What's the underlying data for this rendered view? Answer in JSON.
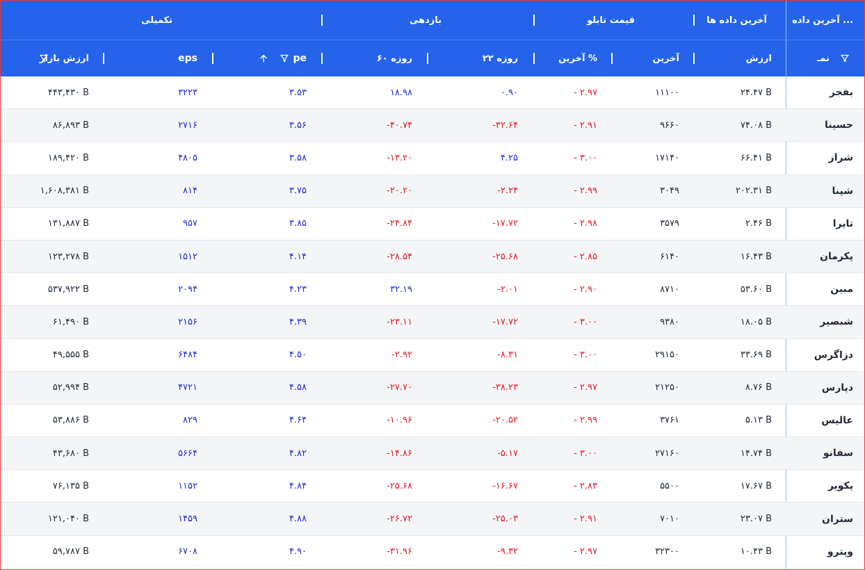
{
  "top_headers": {
    "latest_data": "آخرین داده ...",
    "latest_datas": "آخرین داده ها",
    "board_price": "قیمت تابلو",
    "returns": "بازدهی",
    "supplementary": "تکمیلی"
  },
  "columns": {
    "symbol": "نمـ",
    "value": "ارزش",
    "last": "آخرین",
    "last_pct": "آخرین %",
    "r22": "۲۲ روزه",
    "r60": "۶۰ روزه",
    "pe": "pe",
    "eps": "eps",
    "market_cap": "ارزش بازار"
  },
  "icons": {
    "filter": "filter-icon",
    "sort_up": "sort-up-arrow-icon"
  },
  "colors": {
    "header_bg": "#2563eb",
    "negative": "#e31b23",
    "positive": "#1e2bd6",
    "frame": "#e53935"
  },
  "rows": [
    {
      "symbol": "بفجر",
      "value": "۲۴.۴۷ B",
      "last": "۱۱۱۰۰",
      "last_pct": "- ۲.۹۷",
      "r22": "۰.۹۰",
      "r22_pos": true,
      "r60": "۱۸.۹۸",
      "r60_pos": true,
      "pe": "۳.۵۳",
      "eps": "۳۲۲۳",
      "market_cap": "۴۴۳,۴۳۰ B"
    },
    {
      "symbol": "حسینا",
      "value": "۷۴.۰۸ B",
      "last": "۹۶۶۰",
      "last_pct": "- ۲.۹۱",
      "r22": "-۳۲.۶۴",
      "r22_pos": false,
      "r60": "-۴۰.۷۴",
      "r60_pos": false,
      "pe": "۳.۵۶",
      "eps": "۲۷۱۶",
      "market_cap": "۸۶,۸۹۳ B"
    },
    {
      "symbol": "شراز",
      "value": "۶۶.۴۱ B",
      "last": "۱۷۱۴۰",
      "last_pct": "- ۳.۰۰",
      "r22": "۴.۲۵",
      "r22_pos": true,
      "r60": "-۱۳.۲۰",
      "r60_pos": false,
      "pe": "۳.۵۸",
      "eps": "۴۸۰۵",
      "market_cap": "۱۸۹,۴۲۰ B"
    },
    {
      "symbol": "شپنا",
      "value": "۲۰۲.۳۱ B",
      "last": "۳۰۴۹",
      "last_pct": "- ۲.۹۹",
      "r22": "-۲.۲۴",
      "r22_pos": false,
      "r60": "-۲۰.۲۰",
      "r60_pos": false,
      "pe": "۳.۷۵",
      "eps": "۸۱۴",
      "market_cap": "۱,۶۰۸,۳۸۱ B"
    },
    {
      "symbol": "تایرا",
      "value": "۲.۴۶ B",
      "last": "۳۵۷۹",
      "last_pct": "- ۲.۹۸",
      "r22": "-۱۷.۷۲",
      "r22_pos": false,
      "r60": "-۲۴.۸۴",
      "r60_pos": false,
      "pe": "۳.۸۵",
      "eps": "۹۵۷",
      "market_cap": "۱۳۱,۸۸۷ B"
    },
    {
      "symbol": "پکرمان",
      "value": "۱۶.۴۳ B",
      "last": "۶۱۴۰",
      "last_pct": "- ۲.۸۵",
      "r22": "-۲۵.۶۸",
      "r22_pos": false,
      "r60": "-۲۸.۵۴",
      "r60_pos": false,
      "pe": "۴.۱۴",
      "eps": "۱۵۱۲",
      "market_cap": "۱۲۳,۲۷۸ B"
    },
    {
      "symbol": "مبین",
      "value": "۵۳.۶۰ B",
      "last": "۸۷۱۰",
      "last_pct": "- ۲.۹۰",
      "r22": "-۲.۰۱",
      "r22_pos": false,
      "r60": "۳۲.۱۹",
      "r60_pos": true,
      "pe": "۴.۲۳",
      "eps": "۲۰۹۴",
      "market_cap": "۵۳۷,۹۲۲ B"
    },
    {
      "symbol": "شبصیر",
      "value": "۱۸.۰۵ B",
      "last": "۹۳۸۰",
      "last_pct": "- ۳.۰۰",
      "r22": "-۱۷.۷۲",
      "r22_pos": false,
      "r60": "-۲۳.۱۱",
      "r60_pos": false,
      "pe": "۴.۳۹",
      "eps": "۲۱۵۶",
      "market_cap": "۶۱,۴۹۰ B"
    },
    {
      "symbol": "دزاگرس",
      "value": "۳۳.۶۹ B",
      "last": "۲۹۱۵۰",
      "last_pct": "- ۳.۰۰",
      "r22": "-۸.۳۱",
      "r22_pos": false,
      "r60": "-۲.۹۲",
      "r60_pos": false,
      "pe": "۴.۵۰",
      "eps": "۶۴۸۴",
      "market_cap": "۴۹,۵۵۵ B"
    },
    {
      "symbol": "دپارس",
      "value": "۸.۷۶ B",
      "last": "۲۱۲۵۰",
      "last_pct": "- ۲.۹۷",
      "r22": "-۳۸.۲۳",
      "r22_pos": false,
      "r60": "-۲۷.۷۰",
      "r60_pos": false,
      "pe": "۴.۵۸",
      "eps": "۴۷۲۱",
      "market_cap": "۵۲,۹۹۴ B"
    },
    {
      "symbol": "عالیس",
      "value": "۵.۱۳ B",
      "last": "۳۷۶۱",
      "last_pct": "- ۲.۹۹",
      "r22": "-۲۰.۵۲",
      "r22_pos": false,
      "r60": "-۱۰.۹۶",
      "r60_pos": false,
      "pe": "۴.۶۴",
      "eps": "۸۲۹",
      "market_cap": "۵۳,۸۸۶ B"
    },
    {
      "symbol": "سفانو",
      "value": "۱۴.۷۴ B",
      "last": "۲۷۱۶۰",
      "last_pct": "- ۳.۰۰",
      "r22": "-۵.۱۷",
      "r22_pos": false,
      "r60": "-۱۴.۸۶",
      "r60_pos": false,
      "pe": "۴.۸۲",
      "eps": "۵۶۶۴",
      "market_cap": "۴۳,۶۸۰ B"
    },
    {
      "symbol": "پکویر",
      "value": "۱۷.۶۷ B",
      "last": "۵۵۰۰",
      "last_pct": "- ۲.۸۳",
      "r22": "-۱۶.۶۷",
      "r22_pos": false,
      "r60": "-۲۵.۶۸",
      "r60_pos": false,
      "pe": "۴.۸۴",
      "eps": "۱۱۵۲",
      "market_cap": "۷۶,۱۳۵ B"
    },
    {
      "symbol": "ستران",
      "value": "۲۳.۰۷ B",
      "last": "۷۰۱۰",
      "last_pct": "- ۲.۹۱",
      "r22": "-۲۵.۰۳",
      "r22_pos": false,
      "r60": "-۲۶.۷۲",
      "r60_pos": false,
      "pe": "۴.۸۸",
      "eps": "۱۴۵۹",
      "market_cap": "۱۲۱,۰۴۰ B"
    },
    {
      "symbol": "وپترو",
      "value": "۱۰.۴۳ B",
      "last": "۳۲۳۰۰",
      "last_pct": "- ۲.۹۷",
      "r22": "-۹.۳۲",
      "r22_pos": false,
      "r60": "-۳۱.۹۶",
      "r60_pos": false,
      "pe": "۴.۹۰",
      "eps": "۶۷۰۸",
      "market_cap": "۵۹,۷۸۷ B"
    }
  ]
}
